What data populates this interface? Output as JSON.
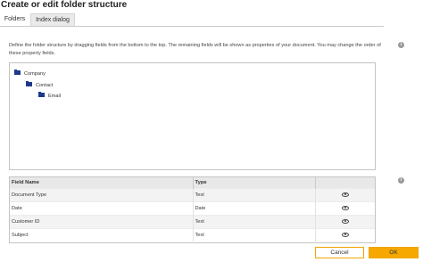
{
  "dialog": {
    "title": "Create or edit folder structure"
  },
  "tabs": [
    {
      "label": "Folders",
      "active": true
    },
    {
      "label": "Index dialog",
      "active": false
    }
  ],
  "description": "Define the folder structure by dragging fields from the bottom to the top. The remaining fields will be shown as properties of your document. You may change the order of these property fields.",
  "tree": [
    {
      "label": "Company",
      "level": 0
    },
    {
      "label": "Contact",
      "level": 1
    },
    {
      "label": "Email",
      "level": 2
    }
  ],
  "grid": {
    "columns": [
      "Field Name",
      "Type",
      ""
    ],
    "rows": [
      {
        "field": "Document Type",
        "type": "Text",
        "visibility_icon": "eye-icon"
      },
      {
        "field": "Date",
        "type": "Date",
        "visibility_icon": "eye-icon"
      },
      {
        "field": "Customer ID",
        "type": "Text",
        "visibility_icon": "eye-icon"
      },
      {
        "field": "Subject",
        "type": "Text",
        "visibility_icon": "eye-icon"
      }
    ]
  },
  "buttons": {
    "cancel": "Cancel",
    "ok": "OK"
  },
  "colors": {
    "accent": "#f6a800",
    "folder": "#1d3a8a",
    "header_bg": "#e8e8e8"
  },
  "icons": {
    "info": "info-icon",
    "folder": "folder-icon",
    "visibility": "eye-icon"
  }
}
